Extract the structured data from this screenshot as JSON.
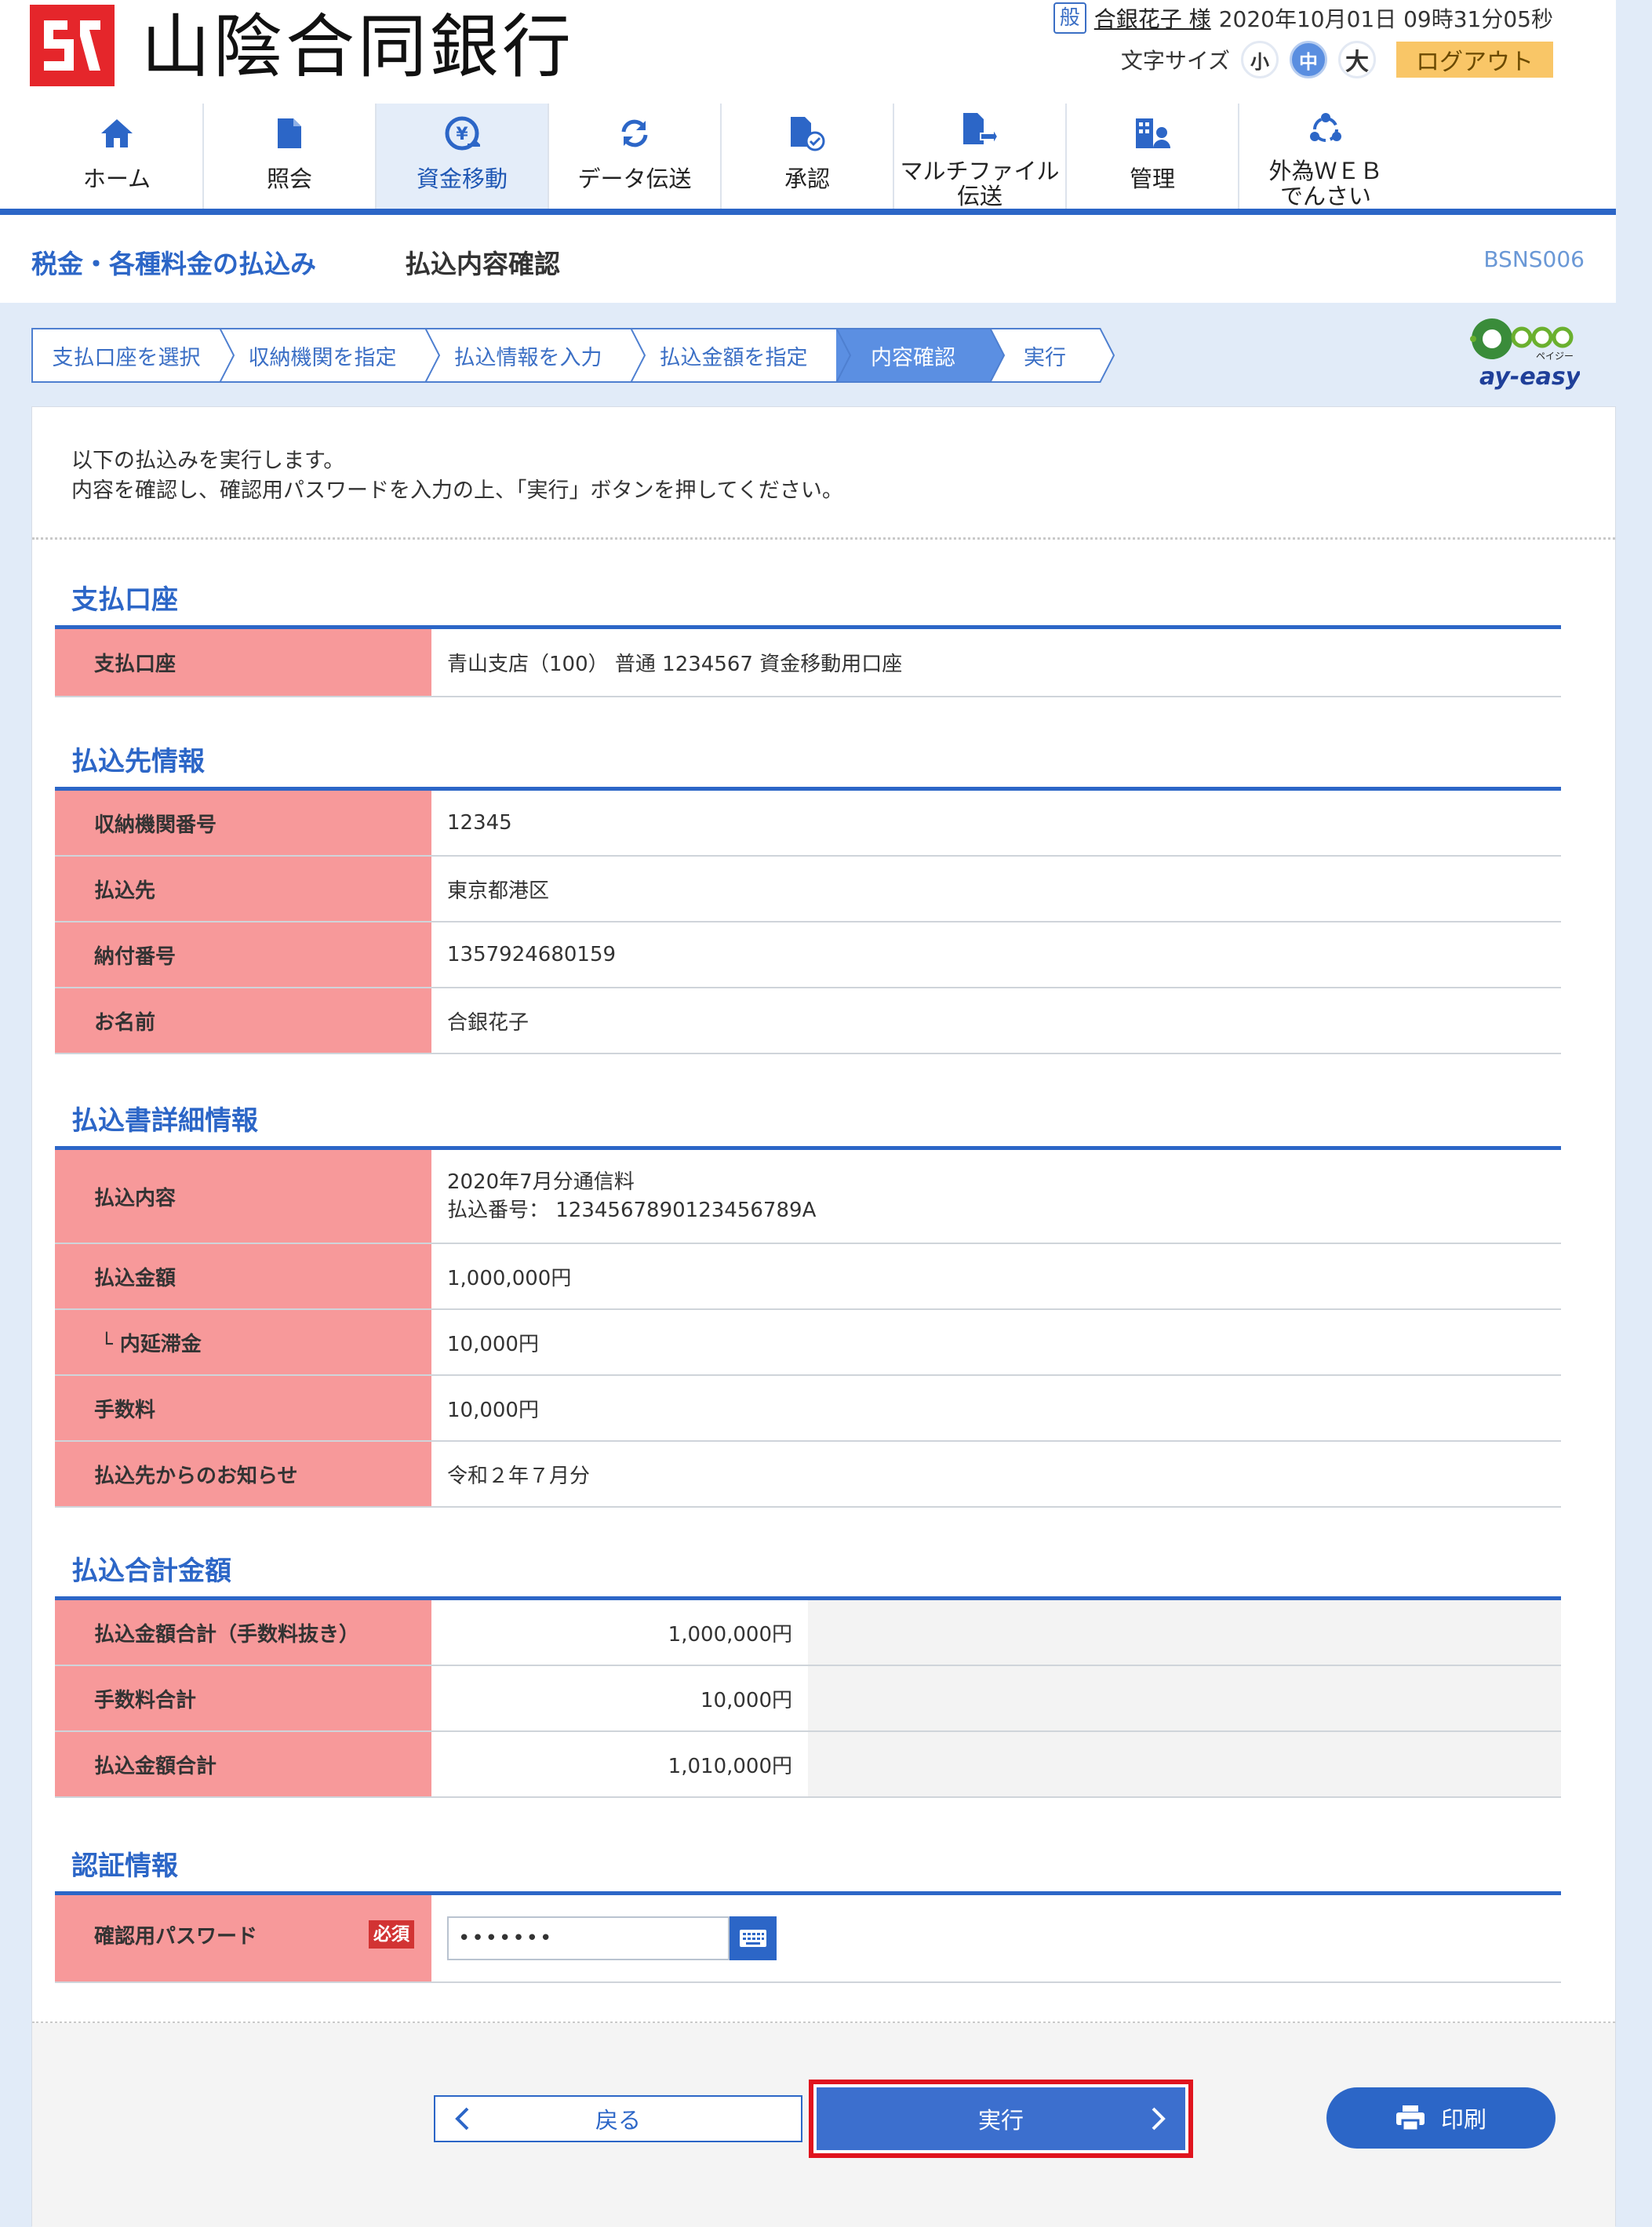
{
  "header": {
    "bank_name": "山陰合同銀行",
    "user_badge": "般",
    "user_name": "合銀花子 様",
    "datetime": "2020年10月01日 09時31分05秒",
    "font_size_label": "文字サイズ",
    "font_small": "小",
    "font_medium": "中",
    "font_large": "大",
    "logout": "ログアウト"
  },
  "nav": [
    {
      "label": "ホーム",
      "icon": "home-icon"
    },
    {
      "label": "照会",
      "icon": "document-icon"
    },
    {
      "label": "資金移動",
      "icon": "yen-transfer-icon",
      "active": true
    },
    {
      "label": "データ伝送",
      "icon": "sync-icon"
    },
    {
      "label": "承認",
      "icon": "approval-icon"
    },
    {
      "label": "マルチファイル",
      "label2": "伝送",
      "icon": "file-transfer-icon"
    },
    {
      "label": "管理",
      "icon": "building-user-icon"
    },
    {
      "label": "外為ＷＥＢ",
      "label2": "でんさい",
      "icon": "network-icon"
    }
  ],
  "title": {
    "category": "税金・各種料金の払込み",
    "page": "払込内容確認",
    "code": "BSNS006"
  },
  "steps": [
    "支払口座を選択",
    "収納機関を指定",
    "払込情報を入力",
    "払込金額を指定",
    "内容確認",
    "実行"
  ],
  "intro": {
    "line1": "以下の払込みを実行します。",
    "line2": "内容を確認し、確認用パスワードを入力の上、「実行」ボタンを押してください。"
  },
  "sections": {
    "account": {
      "title": "支払口座",
      "rows": [
        {
          "label": "支払口座",
          "value": "青山支店（100） 普通 1234567 資金移動用口座"
        }
      ]
    },
    "payee": {
      "title": "払込先情報",
      "rows": [
        {
          "label": "収納機関番号",
          "value": "12345"
        },
        {
          "label": "払込先",
          "value": "東京都港区"
        },
        {
          "label": "納付番号",
          "value": "1357924680159"
        },
        {
          "label": "お名前",
          "value": "合銀花子"
        }
      ]
    },
    "detail": {
      "title": "払込書詳細情報",
      "content_label": "払込内容",
      "content_line1": "2020年7月分通信料",
      "content_line2": "払込番号： 1234567890123456789A",
      "rows": [
        {
          "label": "払込金額",
          "value": "1,000,000円"
        },
        {
          "label": "└ 内延滞金",
          "value": "10,000円"
        },
        {
          "label": "手数料",
          "value": "10,000円"
        },
        {
          "label": "払込先からのお知らせ",
          "value": "令和２年７月分"
        }
      ]
    },
    "total": {
      "title": "払込合計金額",
      "rows": [
        {
          "label": "払込金額合計（手数料抜き）",
          "value": "1,000,000円"
        },
        {
          "label": "手数料合計",
          "value": "10,000円"
        },
        {
          "label": "払込金額合計",
          "value": "1,010,000円"
        }
      ]
    },
    "auth": {
      "title": "認証情報",
      "label": "確認用パスワード",
      "required": "必須",
      "password": "•••••••"
    }
  },
  "buttons": {
    "back": "戻る",
    "execute": "実行",
    "print": "印刷"
  },
  "payeasy_logo": {
    "text": "ay-easy",
    "ruby": "ペイジー"
  },
  "colors": {
    "accent": "#2c66c7",
    "label_bg": "#f7999a",
    "logout_bg": "#f9c667",
    "highlight_border": "#e0141e"
  }
}
